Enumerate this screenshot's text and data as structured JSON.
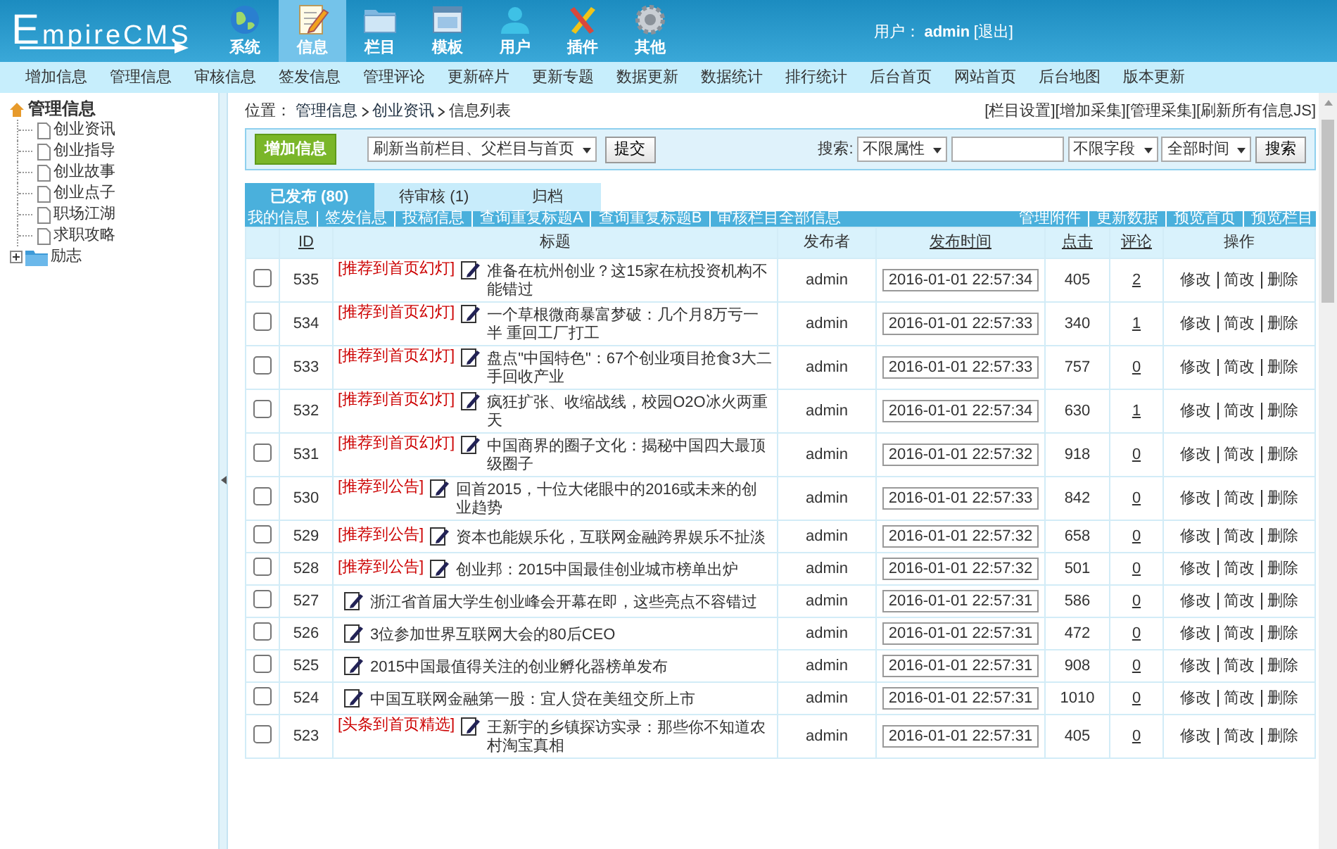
{
  "header": {
    "logo": "EmpireCMS",
    "nav": [
      {
        "label": "系统",
        "selected": false
      },
      {
        "label": "信息",
        "selected": true
      },
      {
        "label": "栏目",
        "selected": false
      },
      {
        "label": "模板",
        "selected": false
      },
      {
        "label": "用户",
        "selected": false
      },
      {
        "label": "插件",
        "selected": false
      },
      {
        "label": "其他",
        "selected": false
      }
    ],
    "user_label": "用户：",
    "user": "admin",
    "logout": "[退出]"
  },
  "submenu": [
    "增加信息",
    "管理信息",
    "审核信息",
    "签发信息",
    "管理评论",
    "更新碎片",
    "更新专题",
    "数据更新",
    "数据统计",
    "排行统计",
    "后台首页",
    "网站首页",
    "后台地图",
    "版本更新"
  ],
  "sidebar": {
    "root": "管理信息",
    "items": [
      {
        "label": "创业资讯",
        "kind": "page"
      },
      {
        "label": "创业指导",
        "kind": "page"
      },
      {
        "label": "创业故事",
        "kind": "page"
      },
      {
        "label": "创业点子",
        "kind": "page"
      },
      {
        "label": "职场江湖",
        "kind": "page"
      },
      {
        "label": "求职攻略",
        "kind": "page"
      },
      {
        "label": "励志",
        "kind": "folder",
        "expanded": false
      }
    ]
  },
  "breadcrumb": {
    "label": "位置：",
    "links": [
      "管理信息",
      "创业资讯"
    ],
    "current": "信息列表"
  },
  "top_links": [
    "[栏目设置]",
    "[增加采集]",
    "[管理采集]",
    "[刷新所有信息JS]"
  ],
  "toolbar": {
    "add_button": "增加信息",
    "refresh_select": "刷新当前栏目、父栏目与首页",
    "submit_button": "提交",
    "search_label": "搜索:",
    "attribute_select": "不限属性",
    "field_select": "不限字段",
    "time_select": "全部时间",
    "search_button": "搜索"
  },
  "tabs": [
    {
      "label": "已发布 (80)",
      "selected": true
    },
    {
      "label": "待审核 (1)",
      "selected": false
    },
    {
      "label": "归档",
      "selected": false
    }
  ],
  "link_bar": {
    "left": [
      "我的信息",
      "签发信息",
      "投稿信息",
      "查询重复标题A",
      "查询重复标题B",
      "审核栏目全部信息"
    ],
    "right": [
      "管理附件",
      "更新数据",
      "预览首页",
      "预览栏目"
    ]
  },
  "table": {
    "columns": [
      {
        "label": "ID",
        "sortable": true
      },
      {
        "label": "标题",
        "sortable": false
      },
      {
        "label": "发布者",
        "sortable": false
      },
      {
        "label": "发布时间",
        "sortable": true
      },
      {
        "label": "点击",
        "sortable": true
      },
      {
        "label": "评论",
        "sortable": true
      },
      {
        "label": "操作",
        "sortable": false
      }
    ],
    "rows": [
      {
        "checked": false,
        "id": "535",
        "tag": "[推荐到首页幻灯]",
        "title": "准备在杭州创业？这15家在杭投资机构不能错过",
        "publisher": "admin",
        "time": "2016-01-01 22:57:34",
        "clicks": "405",
        "comments": "2",
        "actions": [
          "修改",
          "简改",
          "删除"
        ]
      },
      {
        "checked": false,
        "id": "534",
        "tag": "[推荐到首页幻灯]",
        "title": "一个草根微商暴富梦破：几个月8万亏一半 重回工厂打工",
        "publisher": "admin",
        "time": "2016-01-01 22:57:33",
        "clicks": "340",
        "comments": "1",
        "actions": [
          "修改",
          "简改",
          "删除"
        ]
      },
      {
        "checked": false,
        "id": "533",
        "tag": "[推荐到首页幻灯]",
        "title": "盘点\"中国特色\"：67个创业项目抢食3大二手回收产业",
        "publisher": "admin",
        "time": "2016-01-01 22:57:33",
        "clicks": "757",
        "comments": "0",
        "actions": [
          "修改",
          "简改",
          "删除"
        ]
      },
      {
        "checked": false,
        "id": "532",
        "tag": "[推荐到首页幻灯]",
        "title": "疯狂扩张、收缩战线，校园O2O冰火两重天",
        "publisher": "admin",
        "time": "2016-01-01 22:57:34",
        "clicks": "630",
        "comments": "1",
        "actions": [
          "修改",
          "简改",
          "删除"
        ]
      },
      {
        "checked": false,
        "id": "531",
        "tag": "[推荐到首页幻灯]",
        "title": "中国商界的圈子文化：揭秘中国四大最顶级圈子",
        "publisher": "admin",
        "time": "2016-01-01 22:57:32",
        "clicks": "918",
        "comments": "0",
        "actions": [
          "修改",
          "简改",
          "删除"
        ]
      },
      {
        "checked": false,
        "id": "530",
        "tag": "[推荐到公告]",
        "title": "回首2015，十位大佬眼中的2016或未来的创业趋势",
        "publisher": "admin",
        "time": "2016-01-01 22:57:33",
        "clicks": "842",
        "comments": "0",
        "actions": [
          "修改",
          "简改",
          "删除"
        ]
      },
      {
        "checked": false,
        "id": "529",
        "tag": "[推荐到公告]",
        "title": "资本也能娱乐化，互联网金融跨界娱乐不扯淡",
        "publisher": "admin",
        "time": "2016-01-01 22:57:32",
        "clicks": "658",
        "comments": "0",
        "actions": [
          "修改",
          "简改",
          "删除"
        ]
      },
      {
        "checked": false,
        "id": "528",
        "tag": "[推荐到公告]",
        "title": "创业邦：2015中国最佳创业城市榜单出炉",
        "publisher": "admin",
        "time": "2016-01-01 22:57:32",
        "clicks": "501",
        "comments": "0",
        "actions": [
          "修改",
          "简改",
          "删除"
        ]
      },
      {
        "checked": false,
        "id": "527",
        "title": "浙江省首届大学生创业峰会开幕在即，这些亮点不容错过",
        "publisher": "admin",
        "time": "2016-01-01 22:57:31",
        "clicks": "586",
        "comments": "0",
        "actions": [
          "修改",
          "简改",
          "删除"
        ]
      },
      {
        "checked": false,
        "id": "526",
        "title": "3位参加世界互联网大会的80后CEO",
        "publisher": "admin",
        "time": "2016-01-01 22:57:31",
        "clicks": "472",
        "comments": "0",
        "actions": [
          "修改",
          "简改",
          "删除"
        ]
      },
      {
        "checked": false,
        "id": "525",
        "title": "2015中国最值得关注的创业孵化器榜单发布",
        "publisher": "admin",
        "time": "2016-01-01 22:57:31",
        "clicks": "908",
        "comments": "0",
        "actions": [
          "修改",
          "简改",
          "删除"
        ]
      },
      {
        "checked": false,
        "id": "524",
        "title": "中国互联网金融第一股：宜人贷在美纽交所上市",
        "publisher": "admin",
        "time": "2016-01-01 22:57:31",
        "clicks": "1010",
        "comments": "0",
        "actions": [
          "修改",
          "简改",
          "删除"
        ]
      },
      {
        "checked": false,
        "id": "523",
        "tag": "[头条到首页精选]",
        "title": "王新宇的乡镇探访实录：那些你不知道农村淘宝真相",
        "publisher": "admin",
        "time": "2016-01-01 22:57:31",
        "clicks": "405",
        "comments": "0",
        "actions": [
          "修改",
          "简改",
          "删除"
        ]
      }
    ]
  }
}
